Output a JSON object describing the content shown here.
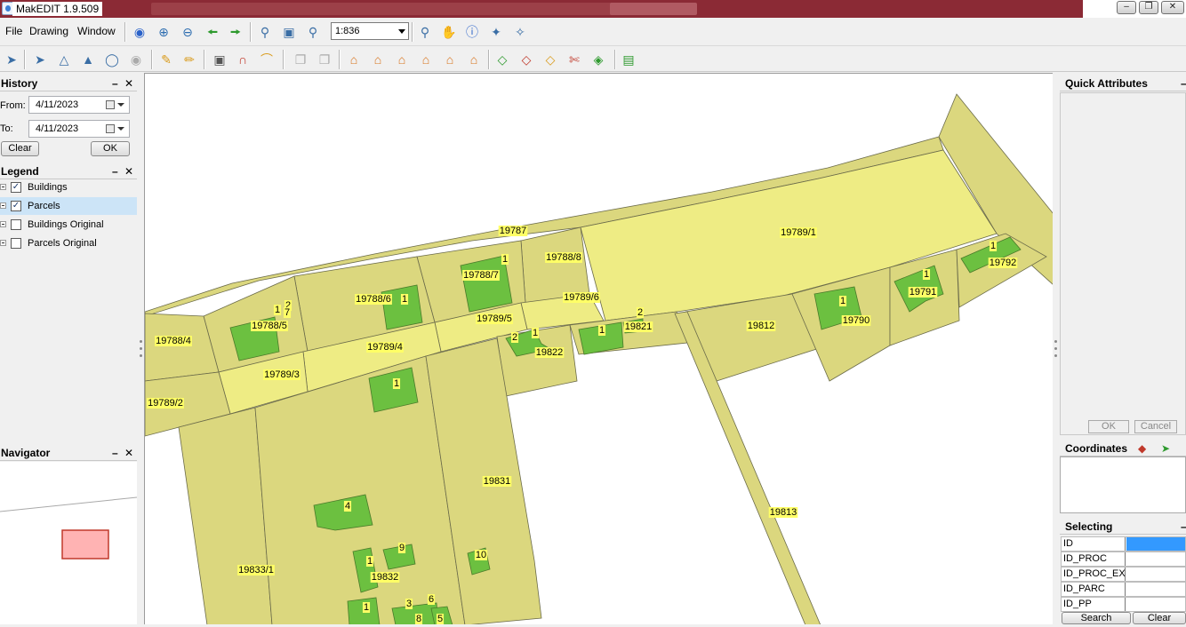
{
  "window": {
    "title": "MakEDIT 1.9.509"
  },
  "menu": {
    "items": [
      "File",
      "Drawing",
      "Window"
    ]
  },
  "toolbar": {
    "scale_value": "1:836"
  },
  "history": {
    "title": "History",
    "from_label": "From:",
    "from_value": "4/11/2023",
    "to_label": "To:",
    "to_value": "4/11/2023",
    "clear_label": "Clear",
    "ok_label": "OK"
  },
  "legend": {
    "title": "Legend",
    "layers": [
      {
        "label": "Buildings",
        "checked": "✓"
      },
      {
        "label": "Parcels",
        "checked": "✓"
      },
      {
        "label": "Buildings Original",
        "checked": ""
      },
      {
        "label": "Parcels Original",
        "checked": ""
      }
    ]
  },
  "navigator": {
    "title": "Navigator"
  },
  "panel_controls": {
    "minimize": "–",
    "close": "✕"
  },
  "quick_attributes": {
    "title": "Quick Attributes",
    "ok_label": "OK",
    "cancel_label": "Cancel"
  },
  "coordinates": {
    "title": "Coordinates"
  },
  "selecting": {
    "title": "Selecting",
    "fields": [
      "ID",
      "ID_PROC",
      "ID_PROC_EXP",
      "ID_PARC",
      "ID_PP"
    ],
    "search_label": "Search",
    "clear_label": "Clear"
  },
  "map": {
    "colors": {
      "parcel": "#dbd77e",
      "parcel_light": "#eeec84",
      "building": "#6cc040",
      "outline": "#6b6b4a"
    },
    "parcel_labels": [
      "19787",
      "19789/1",
      "19788/8",
      "19788/7",
      "19788/6",
      "19789/6",
      "19789/5",
      "19788/5",
      "19788/4",
      "19789/4",
      "19789/3",
      "19789/2",
      "19821",
      "19822",
      "19812",
      "19790",
      "19791",
      "19792",
      "19831",
      "19813",
      "19833/1",
      "19832"
    ],
    "building_labels": [
      "1",
      "1",
      "2",
      "1",
      "1",
      "2",
      "1",
      "1",
      "2",
      "1",
      "1",
      "1",
      "4",
      "9",
      "1",
      "10",
      "1",
      "3",
      "6",
      "8",
      "5",
      "7"
    ]
  }
}
